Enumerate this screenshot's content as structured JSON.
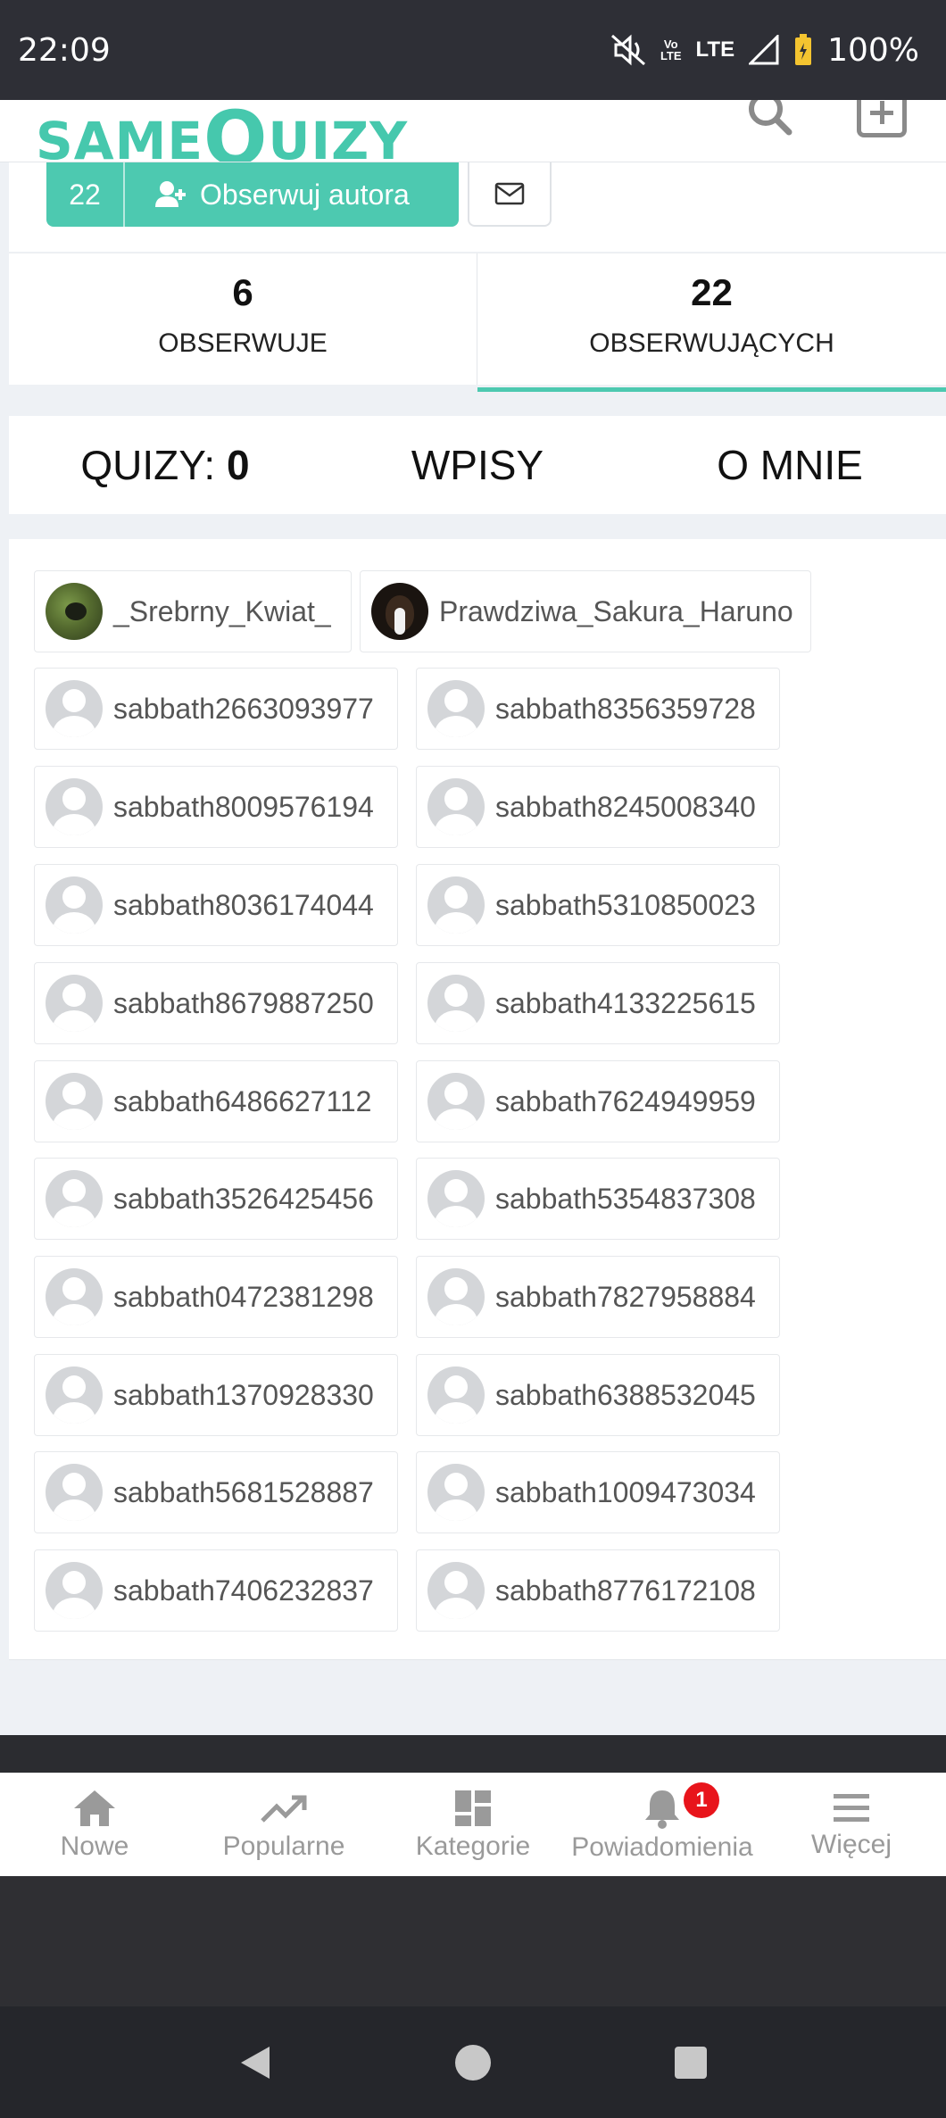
{
  "status_bar": {
    "time": "22:09",
    "network_top": "Vo",
    "network_bottom": "LTE",
    "lte": "LTE",
    "battery": "100%"
  },
  "header": {
    "logo_main": "SAME",
    "logo_q": "Q",
    "logo_rest": "UIZY"
  },
  "profile": {
    "followers_badge": "22",
    "follow_label": "Obserwuj autora"
  },
  "stats": [
    {
      "value": "6",
      "label": "OBSERWUJE"
    },
    {
      "value": "22",
      "label": "OBSERWUJĄCYCH"
    }
  ],
  "tabs": {
    "quizy_label": "QUIZY:",
    "quizy_count": "0",
    "wpisy": "WPISY",
    "o_mnie": "O MNIE"
  },
  "users": [
    "_Srebrny_Kwiat_",
    "Prawdziwa_Sakura_Haruno",
    "sabbath2663093977",
    "sabbath8356359728",
    "sabbath8009576194",
    "sabbath8245008340",
    "sabbath8036174044",
    "sabbath5310850023",
    "sabbath8679887250",
    "sabbath4133225615",
    "sabbath6486627112",
    "sabbath7624949959",
    "sabbath3526425456",
    "sabbath5354837308",
    "sabbath0472381298",
    "sabbath7827958884",
    "sabbath1370928330",
    "sabbath6388532045",
    "sabbath5681528887",
    "sabbath1009473034",
    "sabbath7406232837",
    "sabbath8776172108"
  ],
  "bottom_nav": [
    {
      "label": "Nowe",
      "icon": "home-icon"
    },
    {
      "label": "Popularne",
      "icon": "trending-icon"
    },
    {
      "label": "Kategorie",
      "icon": "grid-icon"
    },
    {
      "label": "Powiadomienia",
      "icon": "bell-icon",
      "badge": "1"
    },
    {
      "label": "Więcej",
      "icon": "menu-icon"
    }
  ],
  "colors": {
    "accent": "#4dc9b0",
    "badge": "#e8141b"
  }
}
